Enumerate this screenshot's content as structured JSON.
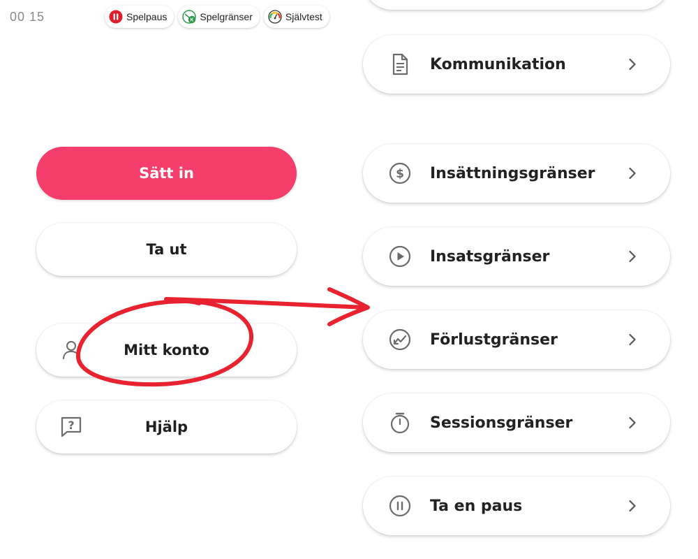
{
  "status_bar": {
    "time": "00 15"
  },
  "top_pills": [
    {
      "label": "Spelpaus",
      "icon": "pause-circle-icon"
    },
    {
      "label": "Spelgränser",
      "icon": "limits-icon"
    },
    {
      "label": "Självtest",
      "icon": "gauge-icon"
    }
  ],
  "left_actions": {
    "deposit_label": "Sätt in",
    "withdraw_label": "Ta ut",
    "account_label": "Mitt konto",
    "help_label": "Hjälp"
  },
  "menu": {
    "items": [
      {
        "label": "Kommunikation",
        "icon": "document-icon"
      },
      {
        "label": "Insättningsgränser",
        "icon": "dollar-circle-icon"
      },
      {
        "label": "Insatsgränser",
        "icon": "play-circle-icon"
      },
      {
        "label": "Förlustgränser",
        "icon": "trend-down-circle-icon"
      },
      {
        "label": "Sessionsgränser",
        "icon": "stopwatch-icon"
      },
      {
        "label": "Ta en paus",
        "icon": "pause-circle-icon"
      }
    ]
  },
  "colors": {
    "primary": "#f53e6c",
    "annotation": "#e8232f",
    "icon_gray": "#6b6b6b"
  }
}
